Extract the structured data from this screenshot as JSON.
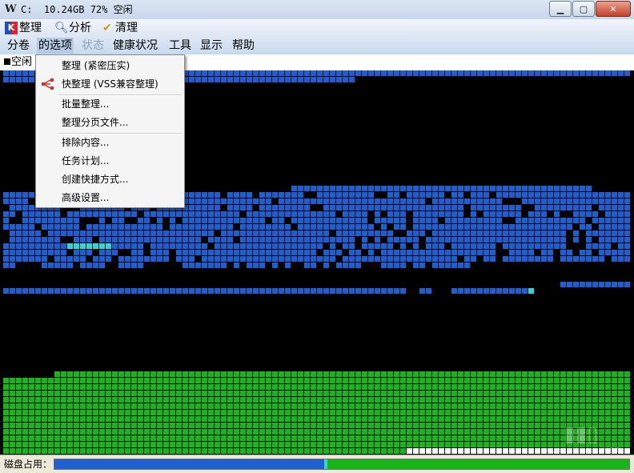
{
  "window": {
    "title": "C:  10.24GB 72% 空闲",
    "minimize": "▁",
    "maximize": "▢",
    "close": "✕"
  },
  "toolbar": {
    "defrag": {
      "label": "整理",
      "icon": "defrag-icon"
    },
    "analyze": {
      "label": "分析",
      "icon": "magnifier-icon"
    },
    "clean": {
      "label": "清理",
      "icon": "broom-icon"
    }
  },
  "menu": {
    "items": [
      {
        "label": "分卷",
        "enabled": true
      },
      {
        "label": "的选项",
        "enabled": true,
        "open": true
      },
      {
        "label": "状态",
        "enabled": false
      },
      {
        "label": "健康状况",
        "enabled": true
      },
      {
        "label": "工具",
        "enabled": true
      },
      {
        "label": "显示",
        "enabled": true
      },
      {
        "label": "帮助",
        "enabled": true
      }
    ]
  },
  "legend": {
    "label": "空闲"
  },
  "dropdown": {
    "items": [
      {
        "label": "整理 (紧密压实)"
      },
      {
        "label": "快整理 (VSS兼容整理)",
        "icon": "branch-icon"
      },
      {
        "label": "批量整理..."
      },
      {
        "label": "整理分页文件..."
      },
      {
        "label": "排除内容..."
      },
      {
        "label": "任务计划..."
      },
      {
        "label": "创建快捷方式..."
      },
      {
        "label": "高级设置..."
      }
    ]
  },
  "status": {
    "label": "磁盘占用：",
    "used_fraction": 0.47,
    "colors": {
      "used": "#1f5fd0",
      "free": "#17b517",
      "marker": "#35d3d3"
    }
  },
  "disk_map": {
    "colors": {
      "used": "#1f5fd0",
      "free": "#000000",
      "system": "#17b517",
      "fragment": "#35d3d3"
    }
  }
}
